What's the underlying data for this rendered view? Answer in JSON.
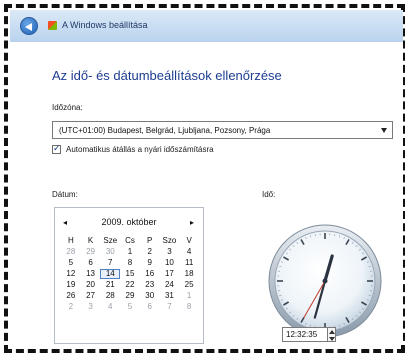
{
  "window": {
    "title": "A Windows beállítása",
    "back_icon": "back-arrow-icon",
    "app_icon": "windows-logo-icon"
  },
  "page": {
    "heading": "Az idő- és dátumbeállítások ellenőrzése",
    "timezone_label": "Időzóna:",
    "timezone_value": "(UTC+01:00) Budapest, Belgrád, Ljubljana, Pozsony, Prága",
    "dst_checked": true,
    "dst_label": "Automatikus átállás a nyári időszámításra",
    "date_label": "Dátum:",
    "time_label": "Idő:"
  },
  "calendar": {
    "month_title": "2009. október",
    "prev_glyph": "◂",
    "next_glyph": "▸",
    "weekdays": [
      "H",
      "K",
      "Sze",
      "Cs",
      "P",
      "Szo",
      "V"
    ],
    "weeks": [
      [
        "28",
        "29",
        "30",
        "1",
        "2",
        "3",
        "4"
      ],
      [
        "5",
        "6",
        "7",
        "8",
        "9",
        "10",
        "11"
      ],
      [
        "12",
        "13",
        "14",
        "15",
        "16",
        "17",
        "18"
      ],
      [
        "19",
        "20",
        "21",
        "22",
        "23",
        "24",
        "25"
      ],
      [
        "26",
        "27",
        "28",
        "29",
        "30",
        "31",
        "1"
      ],
      [
        "2",
        "3",
        "4",
        "5",
        "6",
        "7",
        "8"
      ]
    ],
    "selected_day": "14"
  },
  "clock": {
    "time_value": "12:32:35",
    "hours": 12,
    "minutes": 32,
    "seconds": 35
  },
  "colors": {
    "heading": "#1e3d91",
    "titlebar_top": "#dbe9f7",
    "titlebar_bottom": "#b9d3ee",
    "today_outline": "#4f7fc4"
  }
}
